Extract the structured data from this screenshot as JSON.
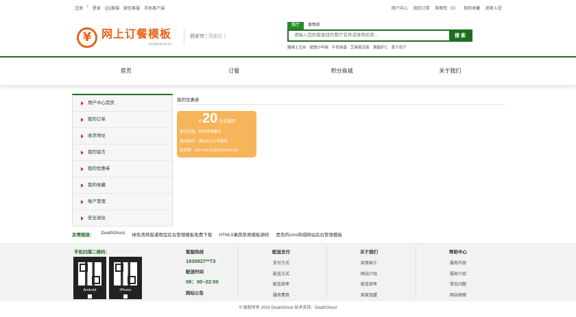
{
  "topbar": {
    "register": "注册",
    "sep": "/",
    "login": "登录",
    "qq": "QQ客服",
    "wechat": "微信客服",
    "mobile": "手机客户端",
    "user_center": "用户中心",
    "my_orders": "我的订单",
    "cart": "购物车（0）",
    "favorites": "我的收藏",
    "merchant": "商家入驻"
  },
  "logo": {
    "title": "网上订餐模板",
    "subtitle": "DeathGhost.cn"
  },
  "city": {
    "name": "西安市",
    "region": "[ 高新区 ]"
  },
  "search": {
    "tab_active": "餐厅",
    "tab_other": "食物名",
    "placeholder": "请输入您所需查找的餐厅名称或食物名称...",
    "button": "搜 索",
    "hot": [
      "酸辣土豆丝",
      "螃蟹炒年糕",
      "牛奶炖蛋",
      "芝麻酱凉面",
      "滑蛋虾仁",
      "蒸汁茄子"
    ]
  },
  "nav": [
    "首页",
    "订餐",
    "积分商城",
    "关于我们"
  ],
  "sidebar": [
    "用户中心首页",
    "我的订单",
    "收货地址",
    "我的留言",
    "我的优惠券",
    "我的收藏",
    "账户管理",
    "安全退出"
  ],
  "main": {
    "title": "我的优惠券",
    "coupon": {
      "currency": "￥",
      "amount": "20",
      "kind": "全店通用",
      "issuer": "发行店铺：好味来快餐店",
      "condition": "使用条件：满299元以可使用",
      "valid": "有效期：2014-09-21至2014-09-30"
    }
  },
  "links": {
    "label": "友情链接：",
    "items": [
      "DeathGhost",
      "绿色清爽版通用型后台管理模板免费下载",
      "HTML5果蔬菜类模板源码",
      "黑色的cms商城网站后台管理模板"
    ]
  },
  "footer": {
    "qr_title": "手机扫描二维码：",
    "qr_android": "Android",
    "qr_iphone": "iPhone",
    "hotline_label": "客服热线",
    "hotline": "1830927**73",
    "time_label": "配送时间",
    "time": "09：00~22:00",
    "notice_label": "网站公告",
    "cols": [
      {
        "title": "配送支付",
        "items": [
          "支付方式",
          "配送方式",
          "配送效率",
          "服务费用"
        ]
      },
      {
        "title": "关于我们",
        "items": [
          "招贤纳士",
          "网站介绍",
          "配送效率",
          "商家加盟"
        ]
      },
      {
        "title": "帮助中心",
        "items": [
          "服务内容",
          "服务介绍",
          "常见问题",
          "网站地图"
        ]
      }
    ]
  },
  "copyright": "© 版权所有 2016 DeathGhost 技术支持：DeathGhost"
}
